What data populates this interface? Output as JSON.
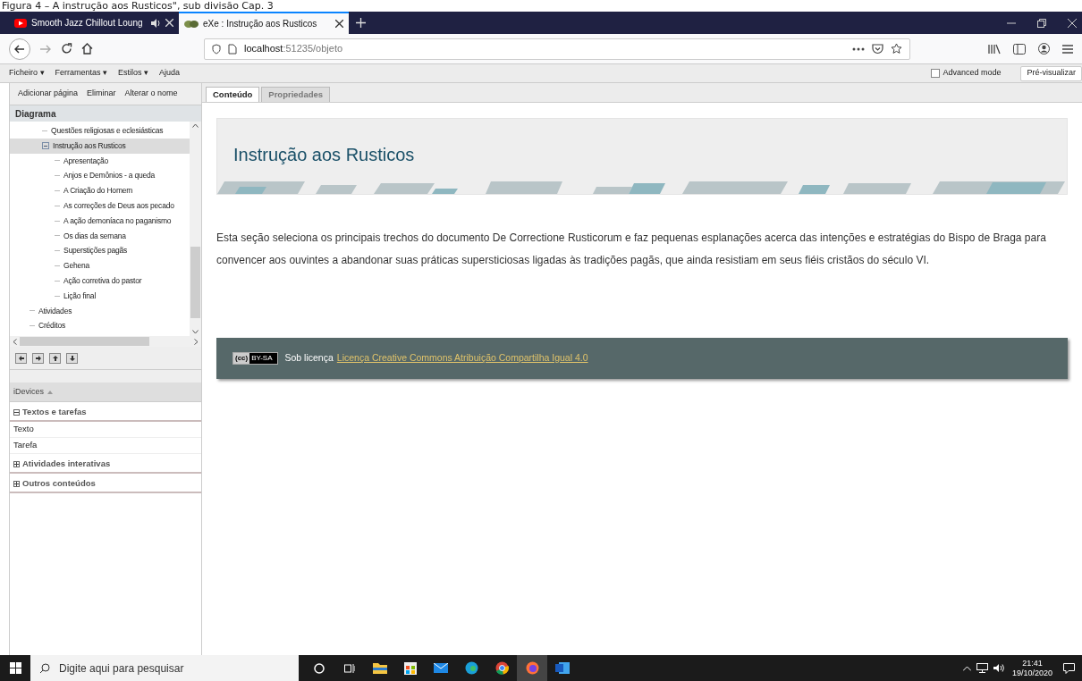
{
  "caption": "Figura 4 – A instrução aos Rusticos\", sub divisão Cap. 3",
  "browser": {
    "tabs": [
      {
        "title": "Smooth Jazz Chillout Loung",
        "kind": "video",
        "audio": true,
        "selected": false
      },
      {
        "title": "eXe : Instrução aos Rusticos",
        "kind": "exe",
        "audio": false,
        "selected": true
      }
    ],
    "url": {
      "host": "localhost",
      "path": ":51235/objeto"
    }
  },
  "app": {
    "menu": [
      "Ficheiro ▾",
      "Ferramentas ▾",
      "Estilos ▾",
      "Ajuda"
    ],
    "advanced_mode": {
      "label": "Advanced mode",
      "checked": false
    },
    "preview_button": "Pré-visualizar",
    "outline": {
      "toolbar": [
        "Adicionar página",
        "Eliminar",
        "Alterar o nome"
      ],
      "heading": "Diagrama",
      "tree": [
        {
          "children": [
            {
              "label": "Questões religiosas e eclesiásticas",
              "selected": false
            },
            {
              "label": "Instrução aos Rusticos",
              "selected": true,
              "expanded": true,
              "children": [
                {
                  "label": "Apresentação",
                  "selected": false
                },
                {
                  "label": "Anjos e Demônios - a queda",
                  "selected": false
                },
                {
                  "label": "A Criação do Homem",
                  "selected": false
                },
                {
                  "label": "As correções de Deus aos pecado",
                  "selected": false
                },
                {
                  "label": "A ação demoníaca no paganismo",
                  "selected": false
                },
                {
                  "label": "Os dias da semana",
                  "selected": false
                },
                {
                  "label": "Superstições pagãs",
                  "selected": false
                },
                {
                  "label": "Gehena",
                  "selected": false
                },
                {
                  "label": "Ação corretiva do pastor",
                  "selected": false
                },
                {
                  "label": "Lição final",
                  "selected": false
                }
              ]
            }
          ]
        },
        {
          "label": "Atividades",
          "selected": false
        },
        {
          "label": "Créditos",
          "selected": false
        }
      ]
    },
    "idevices": {
      "heading": "iDevices",
      "groups": [
        {
          "label": "Textos e tarefas",
          "expanded": true,
          "items": [
            "Texto",
            "Tarefa"
          ]
        },
        {
          "label": "Atividades interativas",
          "expanded": false
        },
        {
          "label": "Outros conteúdos",
          "expanded": false
        }
      ]
    },
    "content_tabs": [
      {
        "label": "Conteúdo",
        "selected": true
      },
      {
        "label": "Propriedades",
        "selected": false
      }
    ],
    "page_title": "Instrução aos Rusticos",
    "paragraph": "Esta seção seleciona os principais trechos do documento De Correctione Rusticorum e faz pequenas esplanações acerca das intenções e estratégias do Bispo de Braga para convencer aos ouvintes a abandonar suas práticas supersticiosas ligadas às tradições pagãs, que ainda resistiam em seus fiéis cristãos do século VI.",
    "license": {
      "badge_left": "(cc)",
      "badge_right": "BY-SA",
      "prefix": "Sob licença",
      "link": "Licença Creative Commons Atribuição Compartilha Igual 4.0"
    }
  },
  "taskbar": {
    "search_placeholder": "Digite aqui para pesquisar",
    "time": "21:41",
    "date": "19/10/2020"
  }
}
